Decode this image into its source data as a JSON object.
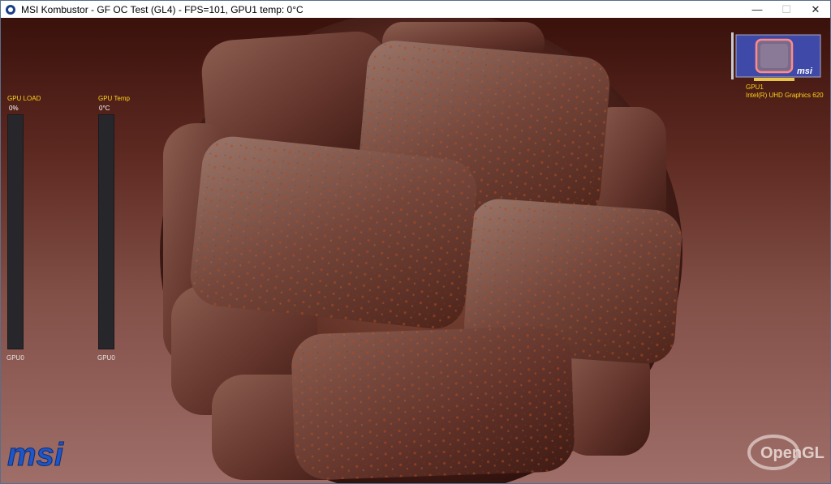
{
  "window": {
    "title": "MSI Kombustor - GF OC Test (GL4) - FPS=101, GPU1 temp: 0°C",
    "minimize_glyph": "—",
    "maximize_glyph": "☐",
    "close_glyph": "✕"
  },
  "meters": {
    "load": {
      "label": "GPU LOAD",
      "value": "0%",
      "foot": "GPU0",
      "level": 0
    },
    "temp": {
      "label": "GPU Temp",
      "value": "0°C",
      "foot": "GPU0",
      "level": 0
    }
  },
  "gpu_info": {
    "id": "GPU1",
    "name": "Intel(R) UHD Graphics 620",
    "card_brand": "msi"
  },
  "logos": {
    "msi": "msi",
    "opengl": "OpenGL"
  },
  "colors": {
    "accent_yellow": "#ffd21a",
    "msi_blue": "#1e55c8"
  },
  "icons": {
    "app": "kombustor-flame-icon",
    "minimize": "minimize-icon",
    "maximize": "maximize-icon",
    "close": "close-icon"
  }
}
